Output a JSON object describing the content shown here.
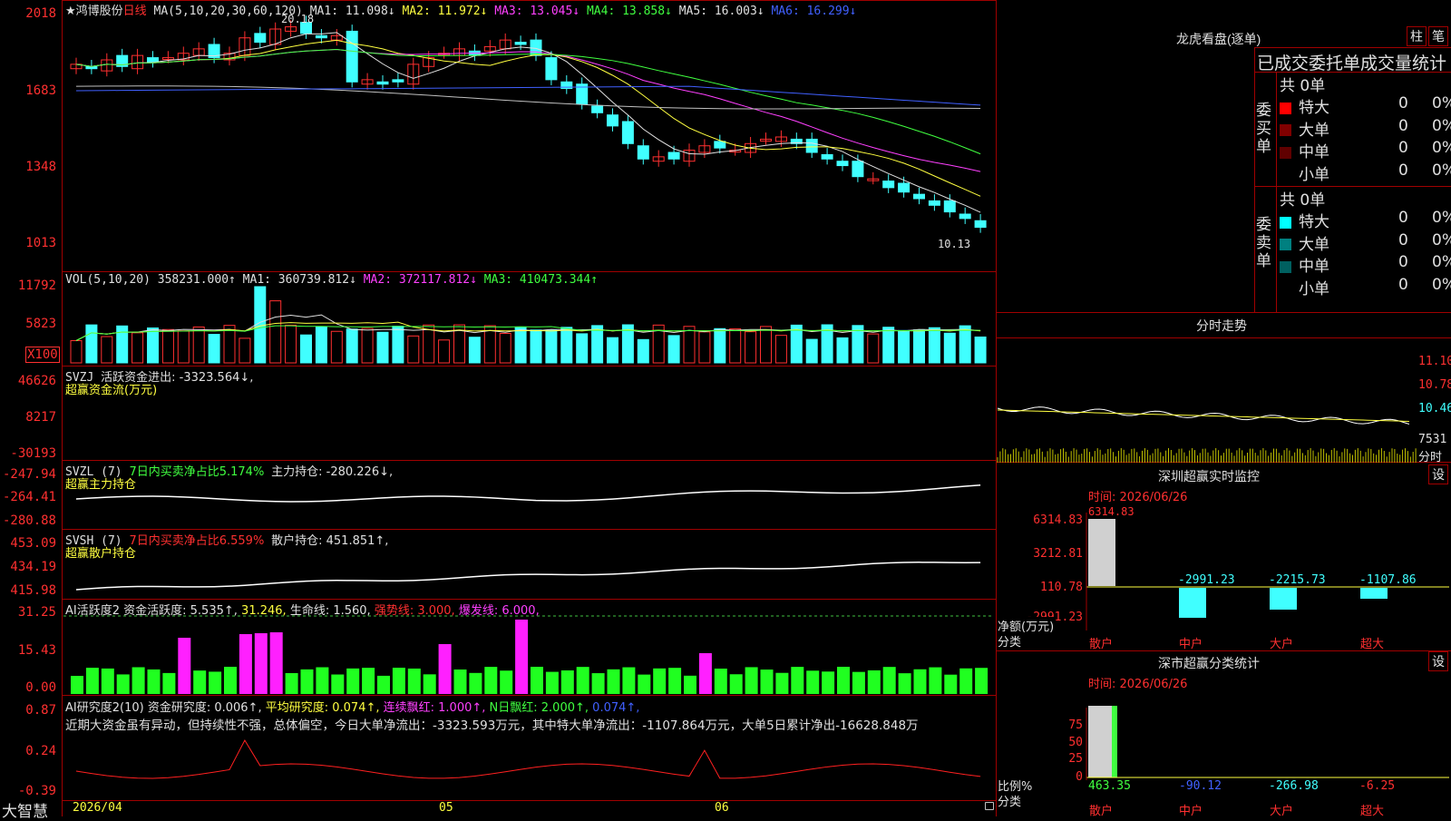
{
  "stock": {
    "name": "鸿博股份",
    "period": "日线",
    "ma_label": "MA(5,10,20,30,60,120)",
    "ma1": "MA1: 11.098↓",
    "ma2": "MA2: 11.972↓",
    "ma3": "MA3: 13.045↓",
    "ma4": "MA4: 13.858↓",
    "ma5": "MA5: 16.003↓",
    "ma6": "MA6: 16.299↓",
    "high_mark": "20.18",
    "low_mark": "10.13"
  },
  "price_axis": [
    "2018",
    "1683",
    "1348",
    "1013"
  ],
  "vol": {
    "label": "VOL(5,10,20)",
    "value": "358231.000↑",
    "ma1": "MA1: 360739.812↓",
    "ma2": "MA2: 372117.812↓",
    "ma3": "MA3: 410473.344↑",
    "axis": [
      "11792",
      "5823"
    ],
    "unit": "X100"
  },
  "svzj": {
    "label": "SVZJ",
    "t1": "活跃资金进出: -3323.564↓,",
    "t2": "超赢资金流(万元)",
    "axis": [
      "46626",
      "8217",
      "-30193"
    ]
  },
  "svzl": {
    "label": "SVZL (7)",
    "t1": "7日内买卖净占比5.174%",
    "t2": "主力持仓: -280.226↓,",
    "t3": "超赢主力持仓",
    "axis": [
      "-247.94",
      "-264.41",
      "-280.88"
    ]
  },
  "svsh": {
    "label": "SVSH (7)",
    "t1": "7日内买卖净占比6.559%",
    "t2": "散户持仓: 451.851↑,",
    "t3": "超赢散户持仓",
    "axis": [
      "453.09",
      "434.19",
      "415.98"
    ]
  },
  "ai1": {
    "t0": "AI活跃度2",
    "t1": "资金活跃度: 5.535↑,",
    "t2": "31.246,",
    "t3": "生命线: 1.560,",
    "t4": "强势线: 3.000,",
    "t5": "爆发线: 6.000,",
    "axis": [
      "31.25",
      "15.43",
      "0.00"
    ]
  },
  "ai2": {
    "t0": "AI研究度2(10)",
    "t1": "资金研究度: 0.006↑,",
    "t2": "平均研究度: 0.074↑,",
    "t3": "连续飘红: 1.000↑,",
    "t4": "N日飘红: 2.000↑,",
    "t5": "0.074↑,",
    "comment": "近期大资金虽有异动，但持续性不强，总体偏空，今日大单净流出：-3323.593万元，其中特大单净流出：-1107.864万元，大单5日累计净出-16628.848万",
    "axis": [
      "0.87",
      "0.24",
      "-0.39"
    ]
  },
  "bottom": {
    "brand": "大智慧",
    "d0": "2026/04",
    "d1": "05",
    "d2": "06"
  },
  "dragon": {
    "title": "龙虎看盘(逐单)",
    "btn1": "柱",
    "btn2": "笔",
    "subtitle": "已成交委托单成交量统计",
    "buy_side": "委买单",
    "sell_side": "委卖单",
    "buy_total": "共 0单",
    "sell_total": "共 0单",
    "buy_rows": [
      {
        "label": "特大",
        "count": "0",
        "pct": "0%"
      },
      {
        "label": "大单",
        "count": "0",
        "pct": "0%"
      },
      {
        "label": "中单",
        "count": "0",
        "pct": "0%"
      },
      {
        "label": "小单",
        "count": "0",
        "pct": "0%"
      }
    ],
    "sell_rows": [
      {
        "label": "特大",
        "count": "0",
        "pct": "0%"
      },
      {
        "label": "大单",
        "count": "0",
        "pct": "0%"
      },
      {
        "label": "中单",
        "count": "0",
        "pct": "0%"
      },
      {
        "label": "小单",
        "count": "0",
        "pct": "0%"
      }
    ]
  },
  "intraday": {
    "title": "分时走势",
    "axis": [
      "11.10",
      "10.78",
      "10.46",
      "7531"
    ],
    "unit": "分时"
  },
  "monitor": {
    "title": "深圳超赢实时监控",
    "btn": "设",
    "time": "时间: 2026/06/26",
    "top_value": "6314.83",
    "axis": [
      "6314.83",
      "3212.81",
      "110.78",
      "-2991.23"
    ],
    "vals": [
      "-2991.23",
      "-2215.73",
      "-1107.86"
    ],
    "ylabel": "净额(万元)",
    "xlabel": "分类",
    "cats": [
      "散户",
      "中户",
      "大户",
      "超大"
    ]
  },
  "classify": {
    "title": "深市超赢分类统计",
    "btn": "设",
    "time": "时间: 2026/06/26",
    "axis": [
      "75",
      "50",
      "25",
      "0"
    ],
    "vals": [
      "463.35",
      "-90.12",
      "-266.98",
      "-6.25"
    ],
    "ylabel": "比例%",
    "xlabel": "分类",
    "cats": [
      "散户",
      "中户",
      "大户",
      "超大"
    ]
  },
  "colors": {
    "up": "#ff3030",
    "down": "#40ffff",
    "border": "#a00000"
  }
}
